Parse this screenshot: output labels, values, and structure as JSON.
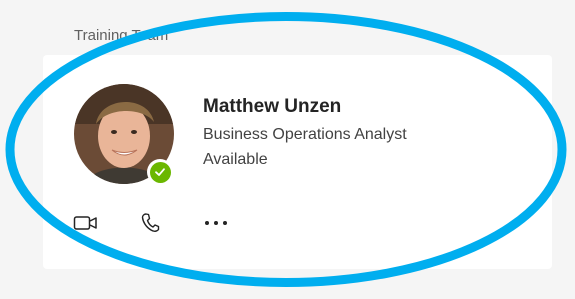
{
  "group": {
    "label": "Training Team"
  },
  "profile": {
    "name": "Matthew Unzen",
    "title": "Business Operations Analyst",
    "status": "Available",
    "presence_color": "#6bb700"
  },
  "actions": [
    {
      "icon": "video-call-icon"
    },
    {
      "icon": "phone-call-icon"
    },
    {
      "icon": "more-options-icon"
    }
  ],
  "highlight_color": "#00aeef"
}
